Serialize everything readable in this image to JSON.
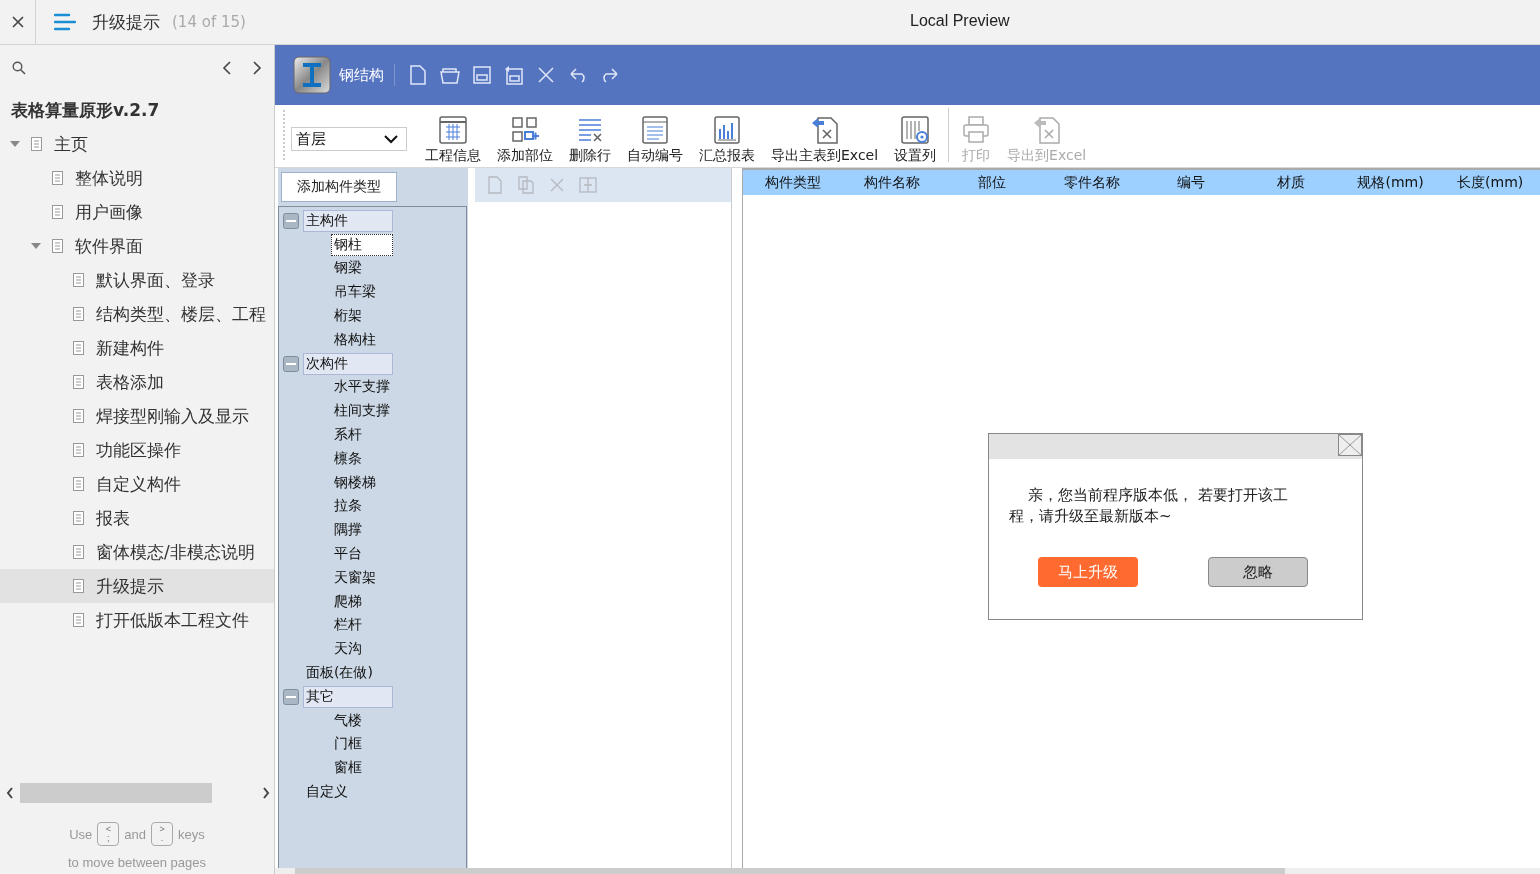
{
  "top_bar": {
    "title": "升级提示",
    "page_count": "(14 of 15)",
    "preview_title": "Local Preview"
  },
  "sidebar": {
    "project_title": "表格算量原形v.2.7",
    "items": [
      {
        "label": "主页",
        "expanded": true,
        "selected": false,
        "children": [
          {
            "label": "整体说明",
            "selected": false
          },
          {
            "label": "用户画像",
            "selected": false
          },
          {
            "label": "软件界面",
            "expanded": true,
            "selected": false,
            "children": [
              {
                "label": "默认界面、登录",
                "selected": false
              },
              {
                "label": "结构类型、楼层、工程",
                "selected": false
              },
              {
                "label": "新建构件",
                "selected": false
              },
              {
                "label": "表格添加",
                "selected": false
              },
              {
                "label": "焊接型刚输入及显示",
                "selected": false
              },
              {
                "label": "功能区操作",
                "selected": false
              },
              {
                "label": "自定义构件",
                "selected": false
              },
              {
                "label": "报表",
                "selected": false
              },
              {
                "label": "窗体模态/非模态说明",
                "selected": false
              },
              {
                "label": "升级提示",
                "selected": true
              },
              {
                "label": "打开低版本工程文件",
                "selected": false
              }
            ]
          }
        ]
      }
    ],
    "footer": {
      "use": "Use",
      "prev_key": [
        "<",
        ";"
      ],
      "and": "and",
      "next_key": [
        ">",
        "."
      ],
      "keys": "keys",
      "line2": "to move between pages"
    }
  },
  "app": {
    "title": "钢结构",
    "floor_select": "首层",
    "toolbar_groups": [
      [
        {
          "label": "工程信息",
          "kind": "grid",
          "disabled": false
        },
        {
          "label": "添加部位",
          "kind": "add",
          "disabled": false
        },
        {
          "label": "删除行",
          "kind": "delete",
          "disabled": false
        },
        {
          "label": "自动编号",
          "kind": "number",
          "disabled": false
        },
        {
          "label": "汇总报表",
          "kind": "chart",
          "disabled": false
        },
        {
          "label": "导出主表到Excel",
          "kind": "export",
          "disabled": false
        },
        {
          "label": "设置列",
          "kind": "columns",
          "disabled": false
        }
      ],
      [
        {
          "label": "打印",
          "kind": "print",
          "disabled": true
        },
        {
          "label": "导出到Excel",
          "kind": "export",
          "disabled": true
        }
      ]
    ],
    "add_type_button": "添加构件类型",
    "tree": [
      {
        "label": "主构件",
        "expanded": true,
        "selected": false,
        "children": [
          {
            "label": "钢柱",
            "selected": true
          },
          {
            "label": "钢梁",
            "selected": false
          },
          {
            "label": "吊车梁",
            "selected": false
          },
          {
            "label": "桁架",
            "selected": false
          },
          {
            "label": "格构柱",
            "selected": false
          }
        ]
      },
      {
        "label": "次构件",
        "expanded": true,
        "selected": false,
        "children": [
          {
            "label": "水平支撑",
            "selected": false
          },
          {
            "label": "柱间支撑",
            "selected": false
          },
          {
            "label": "系杆",
            "selected": false
          },
          {
            "label": "檩条",
            "selected": false
          },
          {
            "label": "钢楼梯",
            "selected": false
          },
          {
            "label": "拉条",
            "selected": false
          },
          {
            "label": "隅撑",
            "selected": false
          },
          {
            "label": "平台",
            "selected": false
          },
          {
            "label": "天窗架",
            "selected": false
          },
          {
            "label": "爬梯",
            "selected": false
          },
          {
            "label": "栏杆",
            "selected": false
          },
          {
            "label": "天沟",
            "selected": false
          }
        ]
      },
      {
        "label": "面板(在做)",
        "selected": false
      },
      {
        "label": "其它",
        "expanded": true,
        "selected": false,
        "children": [
          {
            "label": "气楼",
            "selected": false
          },
          {
            "label": "门框",
            "selected": false
          },
          {
            "label": "窗框",
            "selected": false
          }
        ]
      },
      {
        "label": "自定义",
        "selected": false
      }
    ],
    "table": {
      "columns": [
        "构件类型",
        "构件名称",
        "部位",
        "零件名称",
        "编号",
        "材质",
        "规格(mm)",
        "长度(mm)"
      ]
    },
    "dialog": {
      "message": "亲，您当前程序版本低， 若要打开该工程，请升级至最新版本~",
      "buttons": [
        {
          "label": "马上升级",
          "kind": "primary"
        },
        {
          "label": "忽略",
          "kind": "secondary"
        }
      ]
    }
  }
}
